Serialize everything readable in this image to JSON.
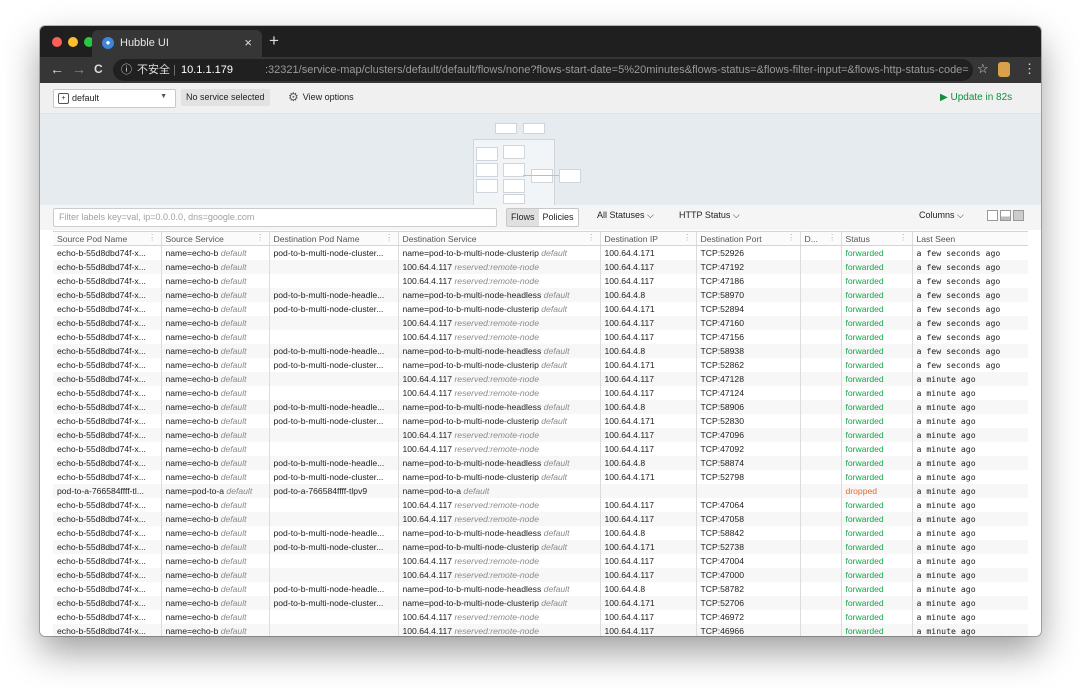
{
  "browser": {
    "tab_title": "Hubble UI",
    "tab_close": "×",
    "new_tab": "+",
    "nav_back": "←",
    "nav_forward": "→",
    "nav_reload": "C",
    "security_label": "不安全",
    "url_host": "10.1.1.179",
    "url_rest": ":32321/service-map/clusters/default/default/flows/none?flows-start-date=5%20minutes&flows-status=&flows-filter-input=&flows-http-status-code=",
    "colors": {
      "frame": "#1f1f1f",
      "toolbar": "#363636",
      "close": "#ff5f57",
      "minimize": "#ffbd2e",
      "maximize": "#28c840"
    }
  },
  "toolbar": {
    "namespace": "default",
    "service": "No service selected",
    "view_options": "View options",
    "update": "Update in 82s",
    "update_color": "#0f8f3c"
  },
  "filters": {
    "placeholder": "Filter labels key=val, ip=0.0.0.0, dns=google.com",
    "flows_label": "Flows",
    "policies_label": "Policies",
    "status_dropdown": "All Statuses",
    "http_dropdown": "HTTP Status",
    "columns_dropdown": "Columns"
  },
  "table": {
    "columns": [
      "Source Pod Name",
      "Source Service",
      "Destination Pod Name",
      "Destination Service",
      "Destination IP",
      "Destination Port",
      "D...",
      "Status",
      "Last Seen"
    ],
    "rows": [
      {
        "src_pod": "echo-b-55d8dbd74f-x...",
        "src_svc": "name=echo-b",
        "src_ns": "default",
        "dst_pod": "pod-to-b-multi-node-cluster...",
        "dst_svc": "name=pod-to-b-multi-node-clusterip",
        "dst_ns": "default",
        "ip": "100.64.4.171",
        "port": "TCP:52926",
        "status": "forwarded",
        "seen": "a few seconds ago"
      },
      {
        "src_pod": "echo-b-55d8dbd74f-x...",
        "src_svc": "name=echo-b",
        "src_ns": "default",
        "dst_pod": "",
        "dst_svc": "100.64.4.117",
        "dst_ns": "reserved:remote-node",
        "ip": "100.64.4.117",
        "port": "TCP:47192",
        "status": "forwarded",
        "seen": "a few seconds ago"
      },
      {
        "src_pod": "echo-b-55d8dbd74f-x...",
        "src_svc": "name=echo-b",
        "src_ns": "default",
        "dst_pod": "",
        "dst_svc": "100.64.4.117",
        "dst_ns": "reserved:remote-node",
        "ip": "100.64.4.117",
        "port": "TCP:47186",
        "status": "forwarded",
        "seen": "a few seconds ago"
      },
      {
        "src_pod": "echo-b-55d8dbd74f-x...",
        "src_svc": "name=echo-b",
        "src_ns": "default",
        "dst_pod": "pod-to-b-multi-node-headle...",
        "dst_svc": "name=pod-to-b-multi-node-headless",
        "dst_ns": "default",
        "ip": "100.64.4.8",
        "port": "TCP:58970",
        "status": "forwarded",
        "seen": "a few seconds ago"
      },
      {
        "src_pod": "echo-b-55d8dbd74f-x...",
        "src_svc": "name=echo-b",
        "src_ns": "default",
        "dst_pod": "pod-to-b-multi-node-cluster...",
        "dst_svc": "name=pod-to-b-multi-node-clusterip",
        "dst_ns": "default",
        "ip": "100.64.4.171",
        "port": "TCP:52894",
        "status": "forwarded",
        "seen": "a few seconds ago"
      },
      {
        "src_pod": "echo-b-55d8dbd74f-x...",
        "src_svc": "name=echo-b",
        "src_ns": "default",
        "dst_pod": "",
        "dst_svc": "100.64.4.117",
        "dst_ns": "reserved:remote-node",
        "ip": "100.64.4.117",
        "port": "TCP:47160",
        "status": "forwarded",
        "seen": "a few seconds ago"
      },
      {
        "src_pod": "echo-b-55d8dbd74f-x...",
        "src_svc": "name=echo-b",
        "src_ns": "default",
        "dst_pod": "",
        "dst_svc": "100.64.4.117",
        "dst_ns": "reserved:remote-node",
        "ip": "100.64.4.117",
        "port": "TCP:47156",
        "status": "forwarded",
        "seen": "a few seconds ago"
      },
      {
        "src_pod": "echo-b-55d8dbd74f-x...",
        "src_svc": "name=echo-b",
        "src_ns": "default",
        "dst_pod": "pod-to-b-multi-node-headle...",
        "dst_svc": "name=pod-to-b-multi-node-headless",
        "dst_ns": "default",
        "ip": "100.64.4.8",
        "port": "TCP:58938",
        "status": "forwarded",
        "seen": "a few seconds ago"
      },
      {
        "src_pod": "echo-b-55d8dbd74f-x...",
        "src_svc": "name=echo-b",
        "src_ns": "default",
        "dst_pod": "pod-to-b-multi-node-cluster...",
        "dst_svc": "name=pod-to-b-multi-node-clusterip",
        "dst_ns": "default",
        "ip": "100.64.4.171",
        "port": "TCP:52862",
        "status": "forwarded",
        "seen": "a few seconds ago"
      },
      {
        "src_pod": "echo-b-55d8dbd74f-x...",
        "src_svc": "name=echo-b",
        "src_ns": "default",
        "dst_pod": "",
        "dst_svc": "100.64.4.117",
        "dst_ns": "reserved:remote-node",
        "ip": "100.64.4.117",
        "port": "TCP:47128",
        "status": "forwarded",
        "seen": "a minute ago"
      },
      {
        "src_pod": "echo-b-55d8dbd74f-x...",
        "src_svc": "name=echo-b",
        "src_ns": "default",
        "dst_pod": "",
        "dst_svc": "100.64.4.117",
        "dst_ns": "reserved:remote-node",
        "ip": "100.64.4.117",
        "port": "TCP:47124",
        "status": "forwarded",
        "seen": "a minute ago"
      },
      {
        "src_pod": "echo-b-55d8dbd74f-x...",
        "src_svc": "name=echo-b",
        "src_ns": "default",
        "dst_pod": "pod-to-b-multi-node-headle...",
        "dst_svc": "name=pod-to-b-multi-node-headless",
        "dst_ns": "default",
        "ip": "100.64.4.8",
        "port": "TCP:58906",
        "status": "forwarded",
        "seen": "a minute ago"
      },
      {
        "src_pod": "echo-b-55d8dbd74f-x...",
        "src_svc": "name=echo-b",
        "src_ns": "default",
        "dst_pod": "pod-to-b-multi-node-cluster...",
        "dst_svc": "name=pod-to-b-multi-node-clusterip",
        "dst_ns": "default",
        "ip": "100.64.4.171",
        "port": "TCP:52830",
        "status": "forwarded",
        "seen": "a minute ago"
      },
      {
        "src_pod": "echo-b-55d8dbd74f-x...",
        "src_svc": "name=echo-b",
        "src_ns": "default",
        "dst_pod": "",
        "dst_svc": "100.64.4.117",
        "dst_ns": "reserved:remote-node",
        "ip": "100.64.4.117",
        "port": "TCP:47096",
        "status": "forwarded",
        "seen": "a minute ago"
      },
      {
        "src_pod": "echo-b-55d8dbd74f-x...",
        "src_svc": "name=echo-b",
        "src_ns": "default",
        "dst_pod": "",
        "dst_svc": "100.64.4.117",
        "dst_ns": "reserved:remote-node",
        "ip": "100.64.4.117",
        "port": "TCP:47092",
        "status": "forwarded",
        "seen": "a minute ago"
      },
      {
        "src_pod": "echo-b-55d8dbd74f-x...",
        "src_svc": "name=echo-b",
        "src_ns": "default",
        "dst_pod": "pod-to-b-multi-node-headle...",
        "dst_svc": "name=pod-to-b-multi-node-headless",
        "dst_ns": "default",
        "ip": "100.64.4.8",
        "port": "TCP:58874",
        "status": "forwarded",
        "seen": "a minute ago"
      },
      {
        "src_pod": "echo-b-55d8dbd74f-x...",
        "src_svc": "name=echo-b",
        "src_ns": "default",
        "dst_pod": "pod-to-b-multi-node-cluster...",
        "dst_svc": "name=pod-to-b-multi-node-clusterip",
        "dst_ns": "default",
        "ip": "100.64.4.171",
        "port": "TCP:52798",
        "status": "forwarded",
        "seen": "a minute ago"
      },
      {
        "src_pod": "pod-to-a-766584ffff-tl...",
        "src_svc": "name=pod-to-a",
        "src_ns": "default",
        "dst_pod": "pod-to-a-766584ffff-tlpv9",
        "dst_svc": "name=pod-to-a",
        "dst_ns": "default",
        "ip": "",
        "port": "",
        "status": "dropped",
        "seen": "a minute ago"
      },
      {
        "src_pod": "echo-b-55d8dbd74f-x...",
        "src_svc": "name=echo-b",
        "src_ns": "default",
        "dst_pod": "",
        "dst_svc": "100.64.4.117",
        "dst_ns": "reserved:remote-node",
        "ip": "100.64.4.117",
        "port": "TCP:47064",
        "status": "forwarded",
        "seen": "a minute ago"
      },
      {
        "src_pod": "echo-b-55d8dbd74f-x...",
        "src_svc": "name=echo-b",
        "src_ns": "default",
        "dst_pod": "",
        "dst_svc": "100.64.4.117",
        "dst_ns": "reserved:remote-node",
        "ip": "100.64.4.117",
        "port": "TCP:47058",
        "status": "forwarded",
        "seen": "a minute ago"
      },
      {
        "src_pod": "echo-b-55d8dbd74f-x...",
        "src_svc": "name=echo-b",
        "src_ns": "default",
        "dst_pod": "pod-to-b-multi-node-headle...",
        "dst_svc": "name=pod-to-b-multi-node-headless",
        "dst_ns": "default",
        "ip": "100.64.4.8",
        "port": "TCP:58842",
        "status": "forwarded",
        "seen": "a minute ago"
      },
      {
        "src_pod": "echo-b-55d8dbd74f-x...",
        "src_svc": "name=echo-b",
        "src_ns": "default",
        "dst_pod": "pod-to-b-multi-node-cluster...",
        "dst_svc": "name=pod-to-b-multi-node-clusterip",
        "dst_ns": "default",
        "ip": "100.64.4.171",
        "port": "TCP:52738",
        "status": "forwarded",
        "seen": "a minute ago"
      },
      {
        "src_pod": "echo-b-55d8dbd74f-x...",
        "src_svc": "name=echo-b",
        "src_ns": "default",
        "dst_pod": "",
        "dst_svc": "100.64.4.117",
        "dst_ns": "reserved:remote-node",
        "ip": "100.64.4.117",
        "port": "TCP:47004",
        "status": "forwarded",
        "seen": "a minute ago"
      },
      {
        "src_pod": "echo-b-55d8dbd74f-x...",
        "src_svc": "name=echo-b",
        "src_ns": "default",
        "dst_pod": "",
        "dst_svc": "100.64.4.117",
        "dst_ns": "reserved:remote-node",
        "ip": "100.64.4.117",
        "port": "TCP:47000",
        "status": "forwarded",
        "seen": "a minute ago"
      },
      {
        "src_pod": "echo-b-55d8dbd74f-x...",
        "src_svc": "name=echo-b",
        "src_ns": "default",
        "dst_pod": "pod-to-b-multi-node-headle...",
        "dst_svc": "name=pod-to-b-multi-node-headless",
        "dst_ns": "default",
        "ip": "100.64.4.8",
        "port": "TCP:58782",
        "status": "forwarded",
        "seen": "a minute ago"
      },
      {
        "src_pod": "echo-b-55d8dbd74f-x...",
        "src_svc": "name=echo-b",
        "src_ns": "default",
        "dst_pod": "pod-to-b-multi-node-cluster...",
        "dst_svc": "name=pod-to-b-multi-node-clusterip",
        "dst_ns": "default",
        "ip": "100.64.4.171",
        "port": "TCP:52706",
        "status": "forwarded",
        "seen": "a minute ago"
      },
      {
        "src_pod": "echo-b-55d8dbd74f-x...",
        "src_svc": "name=echo-b",
        "src_ns": "default",
        "dst_pod": "",
        "dst_svc": "100.64.4.117",
        "dst_ns": "reserved:remote-node",
        "ip": "100.64.4.117",
        "port": "TCP:46972",
        "status": "forwarded",
        "seen": "a minute ago"
      },
      {
        "src_pod": "echo-b-55d8dbd74f-x...",
        "src_svc": "name=echo-b",
        "src_ns": "default",
        "dst_pod": "",
        "dst_svc": "100.64.4.117",
        "dst_ns": "reserved:remote-node",
        "ip": "100.64.4.117",
        "port": "TCP:46966",
        "status": "forwarded",
        "seen": "a minute ago"
      }
    ],
    "status_colors": {
      "forwarded": "#17a64a",
      "dropped": "#e86a2c"
    }
  }
}
